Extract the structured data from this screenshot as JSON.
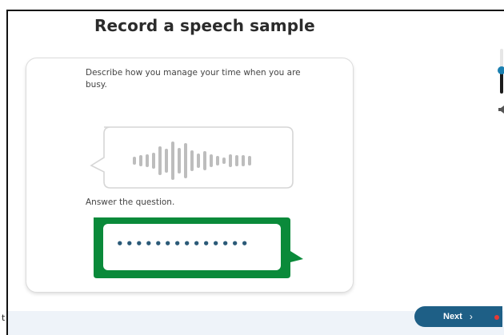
{
  "page": {
    "title": "Record a speech sample",
    "prompt": "Describe how you manage your time when you are busy.",
    "answer_label": "Answer the question.",
    "response_dots": "••••••••••••••"
  },
  "footer": {
    "left_text": "t",
    "next_label": "Next",
    "next_chevron": "›"
  },
  "volume": {
    "level_fraction": 0.55,
    "icon": "speaker-icon"
  },
  "colors": {
    "response_green": "#0a8a3a",
    "accent_blue": "#1e5f86",
    "waveform_gray": "#bdbdbd"
  }
}
